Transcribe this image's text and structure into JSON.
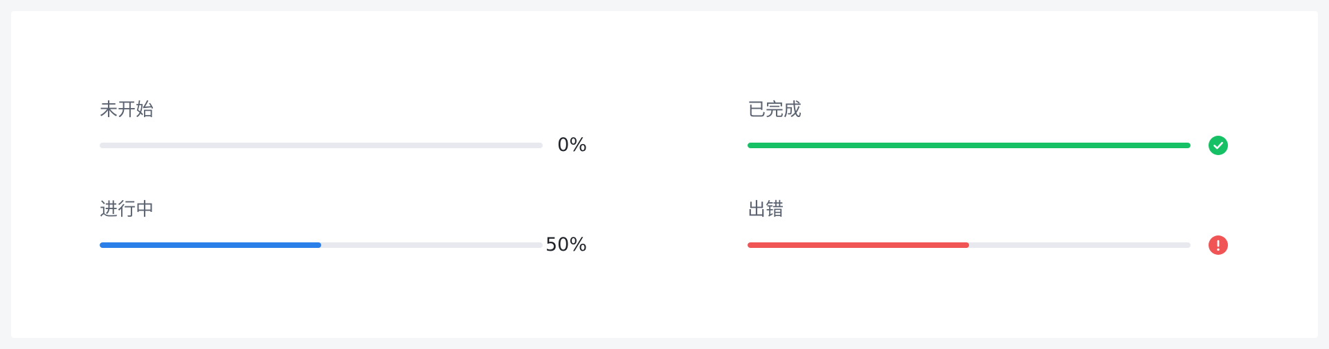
{
  "colors": {
    "track": "#e8e9ee",
    "running": "#2b7fe8",
    "success": "#16c064",
    "error": "#f05454"
  },
  "progress_items": [
    {
      "label": "未开始",
      "percent_text": "0%",
      "value": 0,
      "status": "not-started"
    },
    {
      "label": "进行中",
      "percent_text": "50%",
      "value": 50,
      "status": "running"
    },
    {
      "label": "已完成",
      "value": 100,
      "status": "success",
      "icon": "check-circle-icon"
    },
    {
      "label": "出错",
      "value": 50,
      "status": "error",
      "icon": "exclamation-circle-icon"
    }
  ]
}
